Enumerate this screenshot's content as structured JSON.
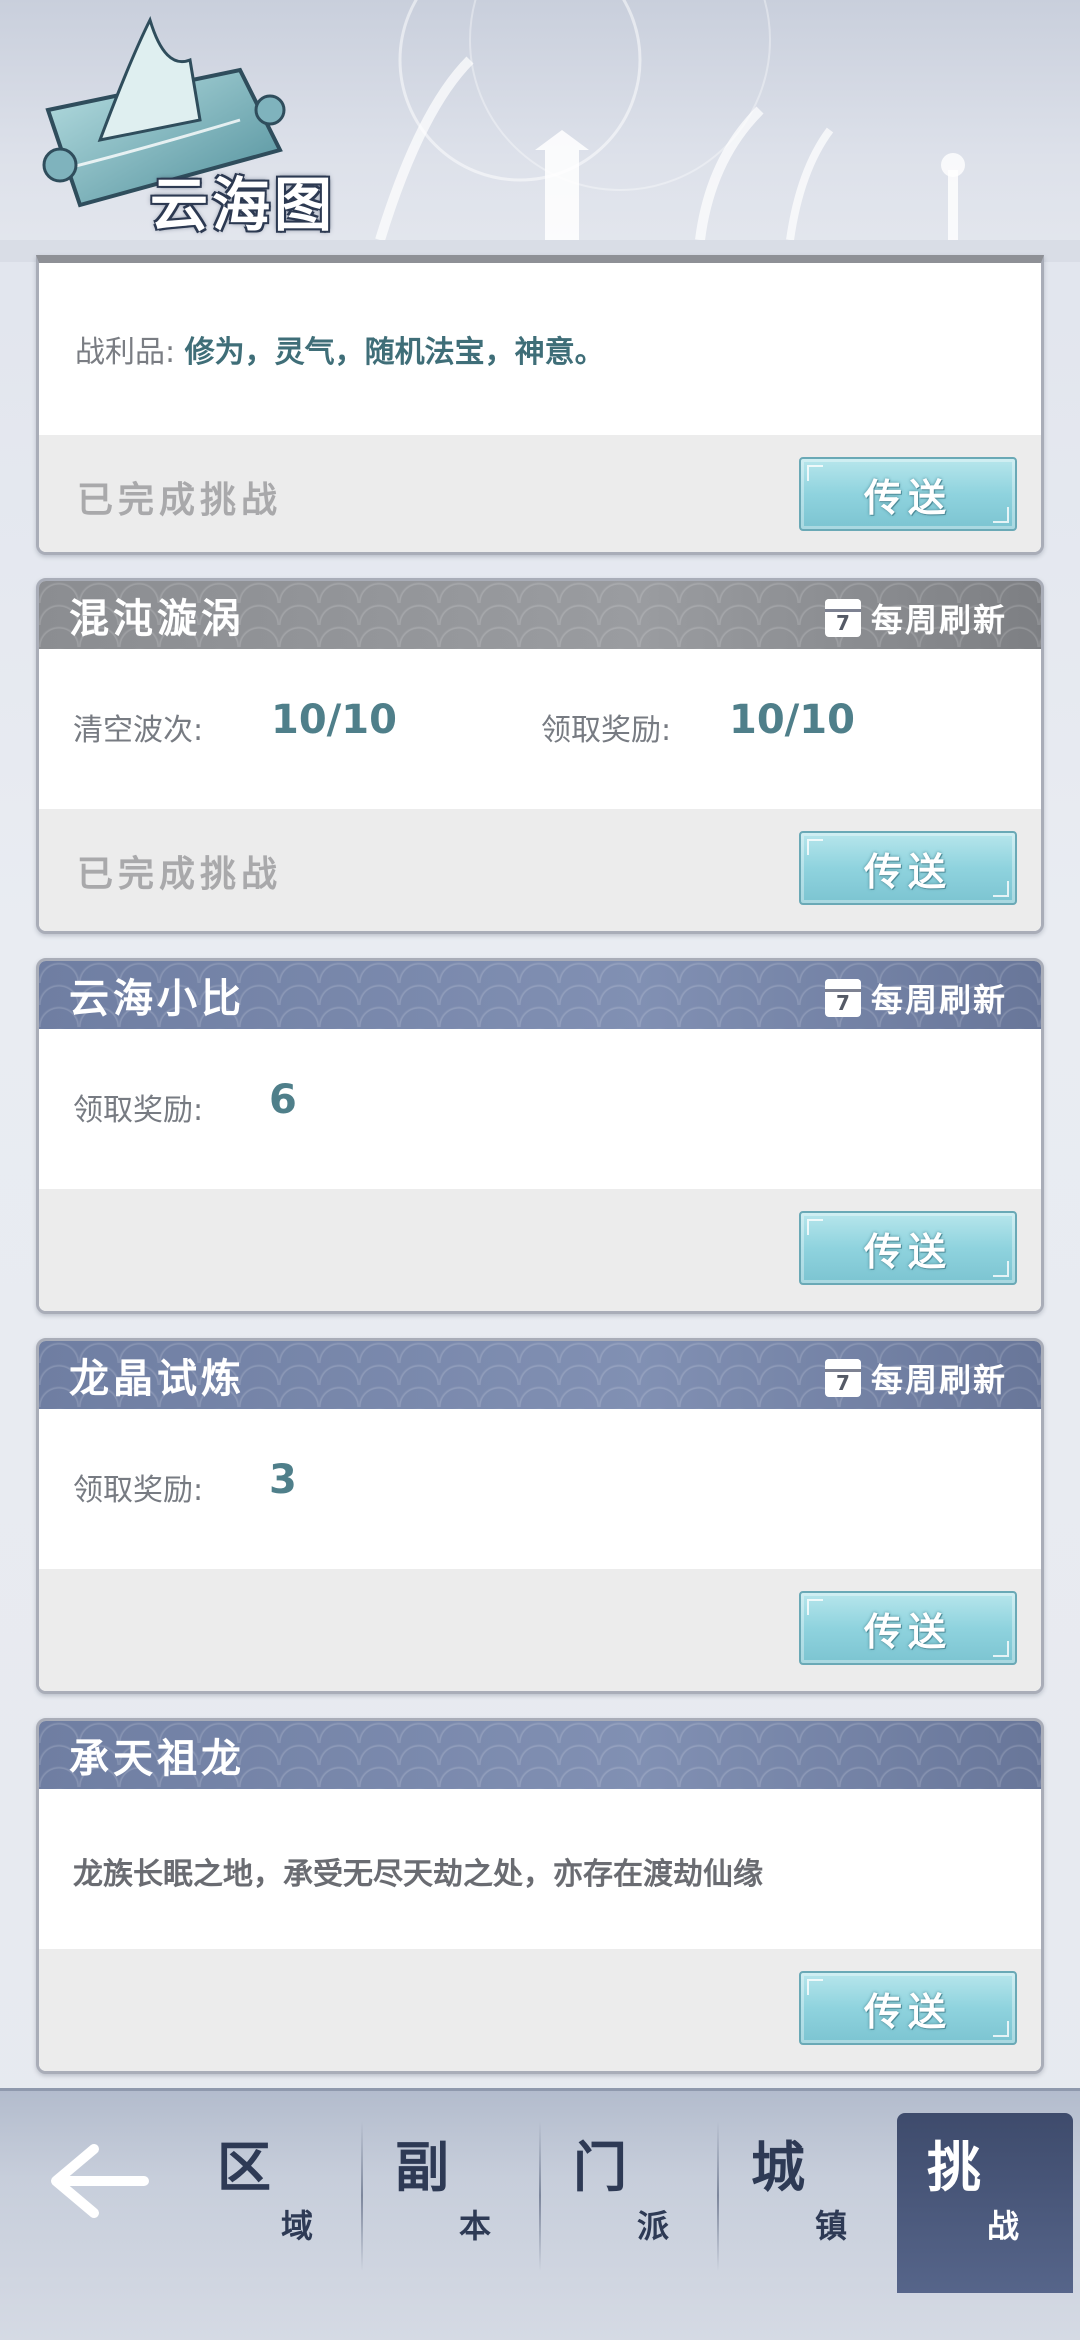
{
  "header": {
    "title": "云海图"
  },
  "cards": [
    {
      "loot_label": "战利品:",
      "loot_value": "修为，灵气，随机法宝，神意。",
      "status": "已完成挑战",
      "button": "传送"
    },
    {
      "title": "混沌漩涡",
      "refresh": "每周刷新",
      "cal_day": "7",
      "stat1_label": "清空波次:",
      "stat1_value": "10/10",
      "stat2_label": "领取奖励:",
      "stat2_value": "10/10",
      "status": "已完成挑战",
      "button": "传送"
    },
    {
      "title": "云海小比",
      "refresh": "每周刷新",
      "cal_day": "7",
      "stat1_label": "领取奖励:",
      "stat1_value": "6",
      "button": "传送"
    },
    {
      "title": "龙晶试炼",
      "refresh": "每周刷新",
      "cal_day": "7",
      "stat1_label": "领取奖励:",
      "stat1_value": "3",
      "button": "传送"
    },
    {
      "title": "承天祖龙",
      "desc": "龙族长眠之地，承受无尽天劫之处，亦存在渡劫仙缘",
      "button": "传送"
    }
  ],
  "nav": {
    "back_icon": "back-arrow-icon",
    "tabs": [
      {
        "big": "区",
        "small": "域"
      },
      {
        "big": "副",
        "small": "本"
      },
      {
        "big": "门",
        "small": "派"
      },
      {
        "big": "城",
        "small": "镇"
      },
      {
        "big": "挑",
        "small": "战",
        "active": true
      }
    ]
  },
  "colors": {
    "accent": "#8fd3de",
    "header_grey": "#8b8d91",
    "header_blue": "#7584a8",
    "nav_active": "#465476"
  }
}
